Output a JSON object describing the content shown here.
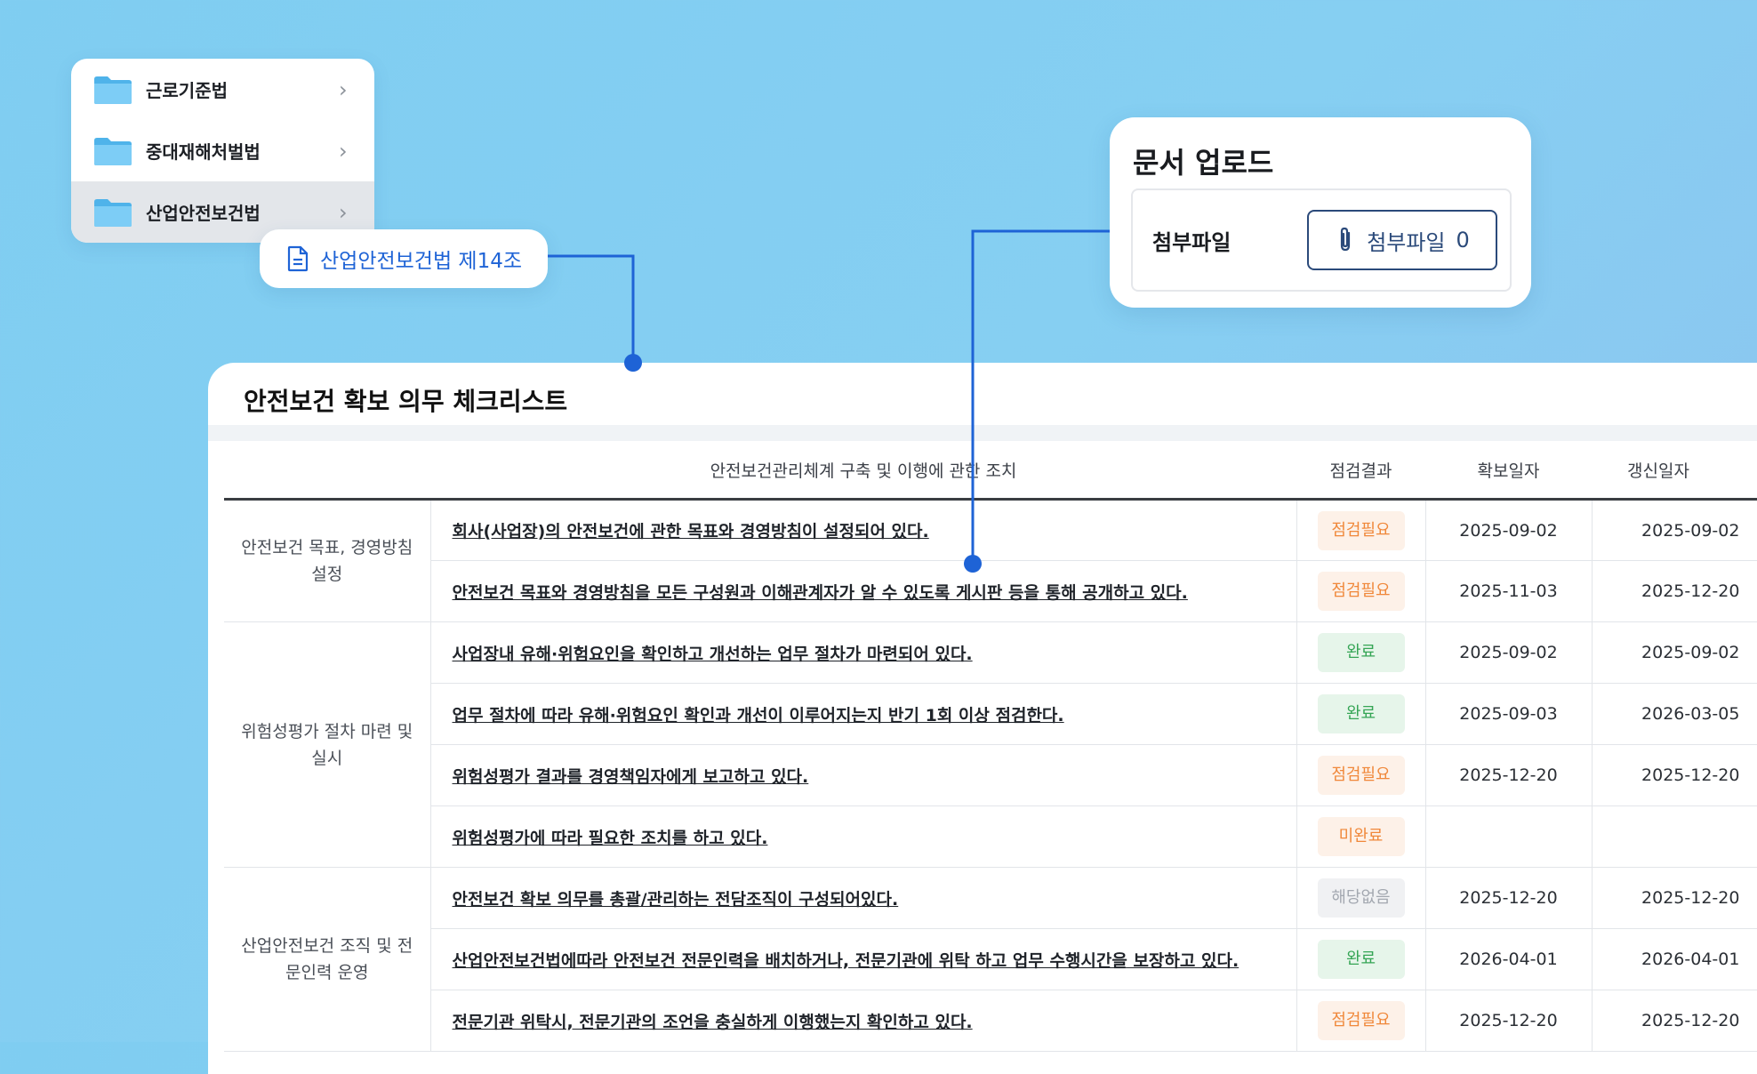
{
  "folders": [
    {
      "label": "근로기준법",
      "selected": false
    },
    {
      "label": "중대재해처벌법",
      "selected": false
    },
    {
      "label": "산업안전보건법",
      "selected": true
    }
  ],
  "doc_chip": {
    "label": "산업안전보건법 제14조"
  },
  "upload": {
    "title": "문서 업로드",
    "field_label": "첨부파일",
    "button_label": "첨부파일",
    "button_count": "0"
  },
  "checklist": {
    "title": "안전보건 확보 의무 체크리스트",
    "headers": {
      "item": "안전보건관리체계 구축 및 이행에 관한 조치",
      "result": "점검결과",
      "secured": "확보일자",
      "renewed": "갱신일자"
    },
    "categories": [
      {
        "label": "안전보건 목표, 경영방침 설정"
      },
      {
        "label": "위험성평가 절차 마련 및 실시"
      },
      {
        "label": "산업안전보건 조직 및 전문인력 운영"
      }
    ],
    "rows": [
      {
        "item": "회사(사업장)의 안전보건에 관한 목표와 경영방침이 설정되어 있다.",
        "result": "점검필요",
        "secured": "2025-09-02",
        "renewed": "2025-09-02"
      },
      {
        "item": "안전보건 목표와 경영방침을 모든 구성원과 이해관계자가 알 수 있도록 게시판 등을 통해 공개하고 있다.",
        "result": "점검필요",
        "secured": "2025-11-03",
        "renewed": "2025-12-20"
      },
      {
        "item": "사업장내 유해·위험요인을 확인하고 개선하는 업무 절차가 마련되어 있다.",
        "result": "완료",
        "secured": "2025-09-02",
        "renewed": "2025-09-02"
      },
      {
        "item": "업무 절차에 따라 유해·위험요인 확인과 개선이 이루어지는지 반기 1회 이상 점검한다.",
        "result": "완료",
        "secured": "2025-09-03",
        "renewed": "2026-03-05"
      },
      {
        "item": "위험성평가 결과를 경영책임자에게 보고하고 있다.",
        "result": "점검필요",
        "secured": "2025-12-20",
        "renewed": "2025-12-20"
      },
      {
        "item": "위험성평가에 따라 필요한 조치를 하고 있다.",
        "result": "미완료",
        "secured": "",
        "renewed": ""
      },
      {
        "item": "안전보건 확보 의무를 총괄/관리하는 전담조직이 구성되어있다.",
        "result": "해당없음",
        "secured": "2025-12-20",
        "renewed": "2025-12-20"
      },
      {
        "item": "산업안전보건법에따라 안전보건 전문인력을 배치하거나, 전문기관에 위탁 하고 업무 수행시간을 보장하고 있다.",
        "result": "완료",
        "secured": "2026-04-01",
        "renewed": "2026-04-01"
      },
      {
        "item": "전문기관 위탁시, 전문기관의 조언을 충실하게 이행했는지 확인하고 있다.",
        "result": "점검필요",
        "secured": "2025-12-20",
        "renewed": "2025-12-20"
      }
    ]
  },
  "colors": {
    "background": "#86cff2",
    "accent": "#1e63d6",
    "badge_need": "#f0883a",
    "badge_done": "#35a555",
    "badge_na": "#a3a8b0"
  }
}
